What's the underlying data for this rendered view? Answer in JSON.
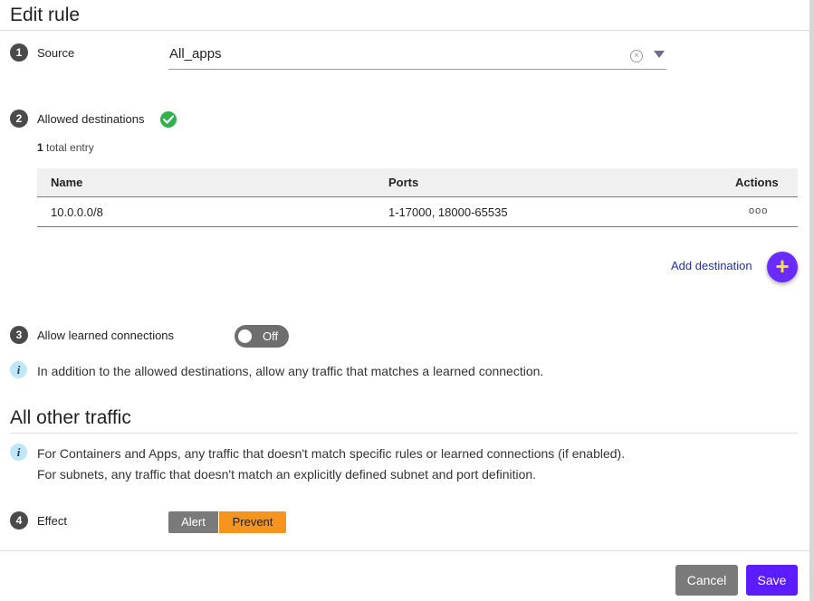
{
  "header": {
    "title": "Edit rule"
  },
  "steps": [
    {
      "number": "1",
      "label": "Source"
    },
    {
      "number": "2",
      "label": "Allowed destinations"
    },
    {
      "number": "3",
      "label": "Allow learned connections"
    },
    {
      "number": "4",
      "label": "Effect"
    }
  ],
  "source": {
    "value": "All_apps",
    "clear_icon": "clear-circle-x",
    "dropdown_icon": "caret-down"
  },
  "destinations": {
    "status_icon": "check-circle",
    "status_color": "#2fb24c",
    "entry_count": "1",
    "entry_suffix": " total entry",
    "columns": [
      "Name",
      "Ports",
      "Actions"
    ],
    "rows": [
      {
        "name": "10.0.0.0/8",
        "ports": "1-17000, 18000-65535",
        "actions": "ooo"
      }
    ],
    "add_label": "Add destination",
    "add_icon": "+"
  },
  "learned": {
    "toggle_state": "Off",
    "info_icon": "i",
    "info_text": "In addition to the allowed destinations, allow any traffic that matches a learned connection."
  },
  "other_traffic": {
    "title": "All other traffic",
    "info_icon": "i",
    "info_line1": "For Containers and Apps, any traffic that doesn't match specific rules or learned connections (if enabled).",
    "info_line2": "For subnets, any traffic that doesn't match an explicitly defined subnet and port definition."
  },
  "effect": {
    "options": [
      "Alert",
      "Prevent"
    ],
    "selected": "Prevent",
    "selected_color": "#f7941d"
  },
  "footer": {
    "cancel_label": "Cancel",
    "save_label": "Save",
    "save_color": "#5b1cff"
  }
}
